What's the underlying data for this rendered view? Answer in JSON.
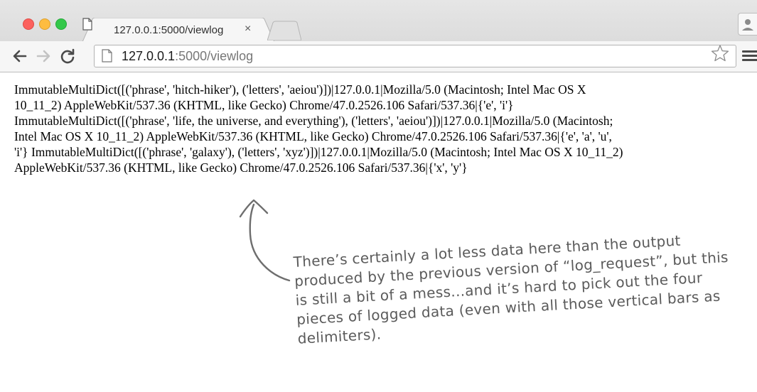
{
  "window": {
    "traffic_lights": [
      "close",
      "minimize",
      "zoom"
    ],
    "colors": {
      "close": "#fc615d",
      "minimize": "#fdbc40",
      "zoom": "#34c84a"
    }
  },
  "tab": {
    "title": "127.0.0.1:5000/viewlog",
    "close_glyph": "×",
    "favicon": "page-icon"
  },
  "toolbar": {
    "url_host": "127.0.0.1",
    "url_rest": ":5000/viewlog",
    "icons": [
      "back-arrow-icon",
      "forward-arrow-icon",
      "reload-icon",
      "page-icon",
      "star-icon",
      "menu-icon",
      "profile-icon"
    ]
  },
  "page": {
    "log_lines": [
      "ImmutableMultiDict([('phrase', 'hitch-hiker'), ('letters', 'aeiou')])|127.0.0.1|Mozilla/5.0 (Macintosh; Intel Mac OS X",
      "10_11_2) AppleWebKit/537.36 (KHTML, like Gecko) Chrome/47.0.2526.106 Safari/537.36|{'e', 'i'}",
      "ImmutableMultiDict([('phrase', 'life, the universe, and everything'), ('letters', 'aeiou')])|127.0.0.1|Mozilla/5.0 (Macintosh;",
      "Intel Mac OS X 10_11_2) AppleWebKit/537.36 (KHTML, like Gecko) Chrome/47.0.2526.106 Safari/537.36|{'e', 'a', 'u',",
      "'i'} ImmutableMultiDict([('phrase', 'galaxy'), ('letters', 'xyz')])|127.0.0.1|Mozilla/5.0 (Macintosh; Intel Mac OS X 10_11_2)",
      "AppleWebKit/537.36 (KHTML, like Gecko) Chrome/47.0.2526.106 Safari/537.36|{'x', 'y'}"
    ]
  },
  "annotation": {
    "lines": [
      "There’s certainly a lot less data here than the output",
      "produced by the previous version of “log_request”, but this",
      "is still a bit of a mess...and it’s hard to pick out the four",
      "pieces of logged data (even with all those vertical bars as",
      "delimiters)."
    ]
  }
}
